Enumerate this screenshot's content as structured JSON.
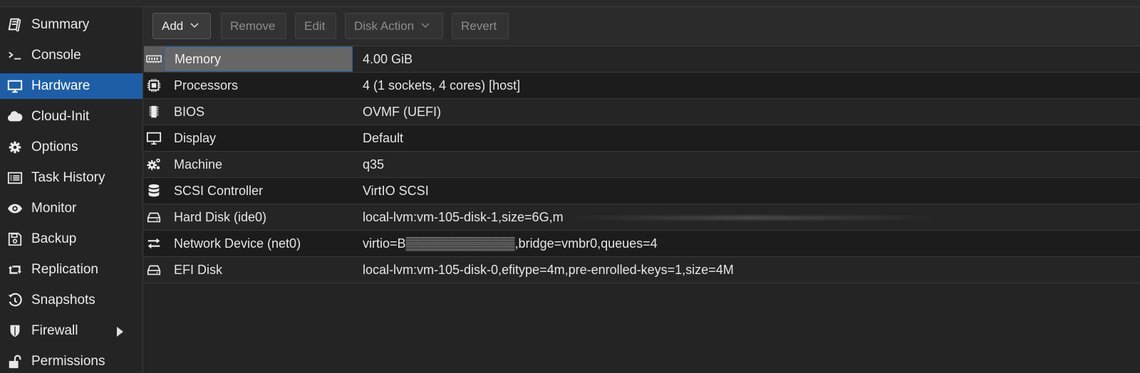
{
  "sidebar": {
    "items": [
      {
        "label": "Summary",
        "icon": "book-icon",
        "active": false
      },
      {
        "label": "Console",
        "icon": "terminal-icon",
        "active": false
      },
      {
        "label": "Hardware",
        "icon": "monitor-icon",
        "active": true
      },
      {
        "label": "Cloud-Init",
        "icon": "cloud-icon",
        "active": false
      },
      {
        "label": "Options",
        "icon": "gear-icon",
        "active": false
      },
      {
        "label": "Task History",
        "icon": "list-icon",
        "active": false
      },
      {
        "label": "Monitor",
        "icon": "eye-icon",
        "active": false
      },
      {
        "label": "Backup",
        "icon": "floppy-icon",
        "active": false
      },
      {
        "label": "Replication",
        "icon": "retweet-icon",
        "active": false
      },
      {
        "label": "Snapshots",
        "icon": "history-icon",
        "active": false
      },
      {
        "label": "Firewall",
        "icon": "shield-icon",
        "active": false,
        "has_submenu": true
      },
      {
        "label": "Permissions",
        "icon": "unlock-icon",
        "active": false
      }
    ]
  },
  "toolbar": {
    "add_label": "Add",
    "remove_label": "Remove",
    "edit_label": "Edit",
    "disk_action_label": "Disk Action",
    "revert_label": "Revert"
  },
  "hardware": {
    "rows": [
      {
        "name": "Memory",
        "value": "4.00 GiB",
        "icon": "memory-icon",
        "selected": true
      },
      {
        "name": "Processors",
        "value": "4 (1 sockets, 4 cores) [host]",
        "icon": "cpu-icon"
      },
      {
        "name": "BIOS",
        "value": "OVMF (UEFI)",
        "icon": "microchip-icon"
      },
      {
        "name": "Display",
        "value": "Default",
        "icon": "desktop-icon"
      },
      {
        "name": "Machine",
        "value": "q35",
        "icon": "cogs-icon"
      },
      {
        "name": "SCSI Controller",
        "value": "VirtIO SCSI",
        "icon": "database-icon"
      },
      {
        "name": "Hard Disk (ide0)",
        "value": "local-lvm:vm-105-disk-1,size=6G,m",
        "icon": "hdd-icon"
      },
      {
        "name": "Network Device (net0)",
        "value": "virtio=B▒▒▒▒▒▒▒▒▒▒▒▒,bridge=vmbr0,queues=4",
        "icon": "exchange-icon"
      },
      {
        "name": "EFI Disk",
        "value": "local-lvm:vm-105-disk-0,efitype=4m,pre-enrolled-keys=1,size=4M",
        "icon": "hdd-icon"
      }
    ]
  },
  "colors": {
    "accent": "#1d5ea7",
    "background": "#242424",
    "row_alt": "#1c1c1c",
    "selected_row": "#666666"
  }
}
